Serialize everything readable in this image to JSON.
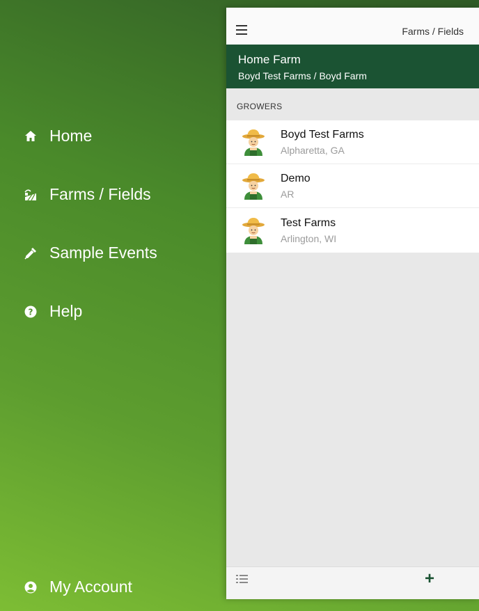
{
  "menu": {
    "items": [
      {
        "label": "Home",
        "icon": "home-icon"
      },
      {
        "label": "Farms / Fields",
        "icon": "farm-fields-icon"
      },
      {
        "label": "Sample Events",
        "icon": "dropper-icon"
      },
      {
        "label": "Help",
        "icon": "help-icon"
      }
    ],
    "account": {
      "label": "My Account",
      "icon": "account-icon"
    }
  },
  "topbar": {
    "title": "Farms / Fields"
  },
  "farm_header": {
    "title": "Home Farm",
    "subtitle": "Boyd Test Farms / Boyd Farm"
  },
  "section": {
    "label": "GROWERS"
  },
  "growers": [
    {
      "name": "Boyd Test Farms",
      "location": "Alpharetta, GA"
    },
    {
      "name": "Demo",
      "location": "AR"
    },
    {
      "name": "Test Farms",
      "location": "Arlington, WI"
    }
  ],
  "bottombar": {
    "add_label": "+"
  },
  "colors": {
    "header_green": "#1b5333",
    "gradient_light": "#7dbd34",
    "gradient_dark": "#2f5a26"
  }
}
